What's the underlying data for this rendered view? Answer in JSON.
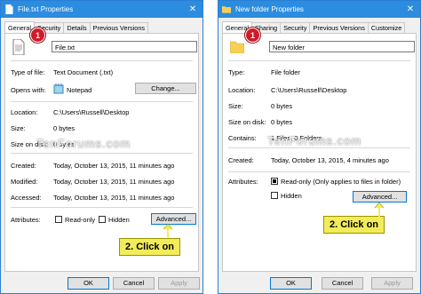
{
  "dialog1": {
    "title": "File.txt Properties",
    "tabs": [
      "General",
      "Security",
      "Details",
      "Previous Versions"
    ],
    "name_value": "File.txt",
    "rows": {
      "type_label": "Type of file:",
      "type_value": "Text Document (.txt)",
      "opens_label": "Opens with:",
      "opens_value": "Notepad",
      "change_label": "Change...",
      "location_label": "Location:",
      "location_value": "C:\\Users\\Russell\\Desktop",
      "size_label": "Size:",
      "size_value": "0 bytes",
      "sizedisk_label": "Size on disk:",
      "sizedisk_value": "0 bytes",
      "created_label": "Created:",
      "created_value": "Today, October 13, 2015, 11 minutes ago",
      "modified_label": "Modified:",
      "modified_value": "Today, October 13, 2015, 11 minutes ago",
      "accessed_label": "Accessed:",
      "accessed_value": "Today, October 13, 2015, 11 minutes ago",
      "attributes_label": "Attributes:",
      "readonly_label": "Read-only",
      "hidden_label": "Hidden",
      "advanced_label": "Advanced..."
    },
    "buttons": {
      "ok": "OK",
      "cancel": "Cancel",
      "apply": "Apply"
    },
    "step_badge": "1",
    "callout": "2. Click on"
  },
  "dialog2": {
    "title": "New folder Properties",
    "tabs": [
      "General",
      "Sharing",
      "Security",
      "Previous Versions",
      "Customize"
    ],
    "name_value": "New folder",
    "rows": {
      "type_label": "Type:",
      "type_value": "File folder",
      "location_label": "Location:",
      "location_value": "C:\\Users\\Russell\\Desktop",
      "size_label": "Size:",
      "size_value": "0 bytes",
      "sizedisk_label": "Size on disk:",
      "sizedisk_value": "0 bytes",
      "contains_label": "Contains:",
      "contains_value": "1 Files, 0 Folders",
      "created_label": "Created:",
      "created_value": "Today, October 13, 2015, 4 minutes ago",
      "attributes_label": "Attributes:",
      "readonly_label": "Read-only (Only applies to files in folder)",
      "hidden_label": "Hidden",
      "advanced_label": "Advanced..."
    },
    "buttons": {
      "ok": "OK",
      "cancel": "Cancel",
      "apply": "Apply"
    },
    "step_badge": "1",
    "callout": "2. Click on"
  },
  "watermark": "TenForums.com",
  "colors": {
    "titlebar": "#2b8ce0",
    "badge": "#d11a2a",
    "callout": "#f2ec5a"
  },
  "icons": {
    "close": "close-icon",
    "title1": "text-file-icon",
    "title2": "folder-icon",
    "notepad": "notepad-icon"
  }
}
